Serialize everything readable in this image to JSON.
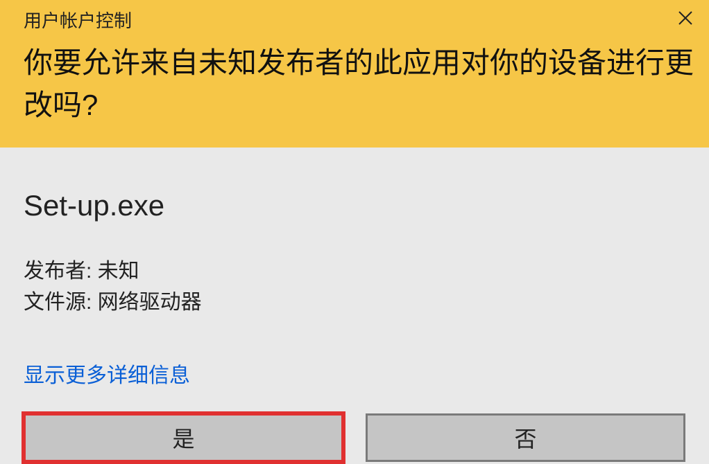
{
  "header": {
    "title": "用户帐户控制",
    "question": "你要允许来自未知发布者的此应用对你的设备进行更改吗?"
  },
  "body": {
    "app_name": "Set-up.exe",
    "publisher_label": "发布者",
    "publisher_value": "未知",
    "source_label": "文件源",
    "source_value": "网络驱动器",
    "more_details": "显示更多详细信息"
  },
  "buttons": {
    "yes": "是",
    "no": "否"
  },
  "colors": {
    "header_bg": "#f6c647",
    "link": "#0a5fd6",
    "highlight_border": "#e03030"
  }
}
